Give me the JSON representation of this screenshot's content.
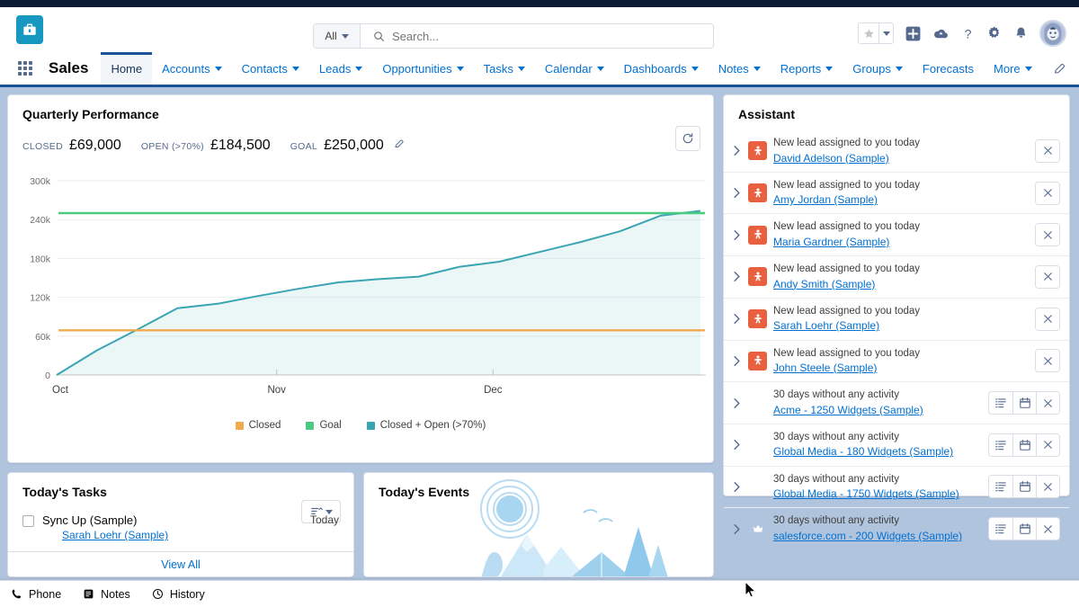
{
  "header": {
    "logo_icon": "briefcase-app-logo",
    "search": {
      "scope": "All",
      "placeholder": "Search...",
      "value": ""
    },
    "icons": [
      {
        "name": "favorites-star-icon",
        "glyph": "star"
      },
      {
        "name": "favorites-dropdown-icon",
        "glyph": "caret"
      },
      {
        "name": "global-actions-icon",
        "glyph": "plus"
      },
      {
        "name": "mobile-app-icon",
        "glyph": "cloud"
      },
      {
        "name": "help-icon",
        "glyph": "question"
      },
      {
        "name": "setup-gear-icon",
        "glyph": "gear"
      },
      {
        "name": "notifications-bell-icon",
        "glyph": "bell"
      },
      {
        "name": "user-avatar",
        "glyph": "avatar"
      }
    ]
  },
  "nav": {
    "app_name": "Sales",
    "items": [
      {
        "label": "Home",
        "has_caret": false,
        "active": true
      },
      {
        "label": "Accounts",
        "has_caret": true,
        "active": false
      },
      {
        "label": "Contacts",
        "has_caret": true,
        "active": false
      },
      {
        "label": "Leads",
        "has_caret": true,
        "active": false
      },
      {
        "label": "Opportunities",
        "has_caret": true,
        "active": false
      },
      {
        "label": "Tasks",
        "has_caret": true,
        "active": false
      },
      {
        "label": "Calendar",
        "has_caret": true,
        "active": false
      },
      {
        "label": "Dashboards",
        "has_caret": true,
        "active": false
      },
      {
        "label": "Notes",
        "has_caret": true,
        "active": false
      },
      {
        "label": "Reports",
        "has_caret": true,
        "active": false
      },
      {
        "label": "Groups",
        "has_caret": true,
        "active": false
      },
      {
        "label": "Forecasts",
        "has_caret": false,
        "active": false
      },
      {
        "label": "More",
        "has_caret": true,
        "active": false
      }
    ]
  },
  "performance": {
    "title": "Quarterly Performance",
    "refresh_icon": "refresh-icon",
    "edit_goal_icon": "pencil-icon",
    "kpis": [
      {
        "label": "CLOSED",
        "value": "£69,000"
      },
      {
        "label": "OPEN (>70%)",
        "value": "£184,500"
      },
      {
        "label": "GOAL",
        "value": "£250,000"
      }
    ]
  },
  "chart_data": {
    "type": "line",
    "title": "Quarterly Performance",
    "xlabel": "",
    "ylabel": "",
    "ylim": [
      0,
      300000
    ],
    "yticks": [
      0,
      60000,
      120000,
      180000,
      240000,
      300000
    ],
    "ytick_labels": [
      "0",
      "60k",
      "120k",
      "180k",
      "240k",
      "300k"
    ],
    "xticks": [
      "Oct",
      "Nov",
      "Dec"
    ],
    "grid": true,
    "legend_position": "bottom",
    "series": [
      {
        "name": "Closed",
        "color": "#f0ab4f",
        "kind": "constant-line",
        "value": 69000
      },
      {
        "name": "Goal",
        "color": "#4bca81",
        "kind": "constant-line",
        "value": 250000
      },
      {
        "name": "Closed + Open (>70%)",
        "color": "#3aa5b2",
        "kind": "cumulative-area",
        "x": [
          "Oct 1",
          "Oct 5",
          "Oct 9",
          "Oct 13",
          "Oct 20",
          "Oct 27",
          "Nov 3",
          "Nov 7",
          "Nov 12",
          "Nov 17",
          "Nov 22",
          "Nov 28",
          "Dec 5",
          "Dec 12",
          "Dec 20",
          "Dec 28",
          "Dec 31"
        ],
        "values": [
          0,
          38000,
          70000,
          103000,
          110000,
          122000,
          133000,
          143000,
          148000,
          152000,
          167000,
          175000,
          190000,
          205000,
          222000,
          246000,
          253500
        ]
      }
    ]
  },
  "assistant": {
    "title": "Assistant",
    "items": [
      {
        "icon": "lead-badge-icon",
        "type": "lead",
        "message": "New lead assigned to you today",
        "link": "David Adelson (Sample)",
        "actions": [
          "close-icon"
        ]
      },
      {
        "icon": "lead-badge-icon",
        "type": "lead",
        "message": "New lead assigned to you today",
        "link": "Amy Jordan (Sample)",
        "actions": [
          "close-icon"
        ]
      },
      {
        "icon": "lead-badge-icon",
        "type": "lead",
        "message": "New lead assigned to you today",
        "link": "Maria Gardner (Sample)",
        "actions": [
          "close-icon"
        ]
      },
      {
        "icon": "lead-badge-icon",
        "type": "lead",
        "message": "New lead assigned to you today",
        "link": "Andy Smith (Sample)",
        "actions": [
          "close-icon"
        ]
      },
      {
        "icon": "lead-badge-icon",
        "type": "lead",
        "message": "New lead assigned to you today",
        "link": "Sarah Loehr (Sample)",
        "actions": [
          "close-icon"
        ]
      },
      {
        "icon": "lead-badge-icon",
        "type": "lead",
        "message": "New lead assigned to you today",
        "link": "John Steele (Sample)",
        "actions": [
          "close-icon"
        ]
      },
      {
        "icon": "opportunity-badge-icon",
        "type": "opportunity",
        "message": "30 days without any activity",
        "link": "Acme - 1250 Widgets (Sample)",
        "actions": [
          "log-a-call-icon",
          "new-event-icon",
          "close-icon"
        ]
      },
      {
        "icon": "opportunity-badge-icon",
        "type": "opportunity",
        "message": "30 days without any activity",
        "link": "Global Media - 180 Widgets (Sample)",
        "actions": [
          "log-a-call-icon",
          "new-event-icon",
          "close-icon"
        ]
      },
      {
        "icon": "opportunity-badge-icon",
        "type": "opportunity",
        "message": "30 days without any activity",
        "link": "Global Media - 1750 Widgets (Sample)",
        "actions": [
          "log-a-call-icon",
          "new-event-icon",
          "close-icon"
        ]
      },
      {
        "icon": "opportunity-badge-icon",
        "type": "opportunity",
        "message": "30 days without any activity",
        "link": "salesforce.com - 200 Widgets (Sample)",
        "actions": [
          "log-a-call-icon",
          "new-event-icon",
          "close-icon"
        ]
      }
    ]
  },
  "tasks": {
    "title": "Today's Tasks",
    "sort_icon": "sort-icon",
    "items": [
      {
        "name": "Sync Up (Sample)",
        "related": "Sarah Loehr (Sample)",
        "due": "Today",
        "checked": false
      }
    ],
    "view_all": "View All"
  },
  "events": {
    "title": "Today's Events",
    "illustration": "camping-scene-illustration"
  },
  "utility_bar": {
    "items": [
      {
        "label": "Phone",
        "icon": "phone-icon"
      },
      {
        "label": "Notes",
        "icon": "notes-icon"
      },
      {
        "label": "History",
        "icon": "history-clock-icon"
      }
    ]
  },
  "colors": {
    "brand": "#1798c1",
    "nav_underline": "#1b5297",
    "link": "#0070d2",
    "closed": "#f0ab4f",
    "goal": "#4bca81",
    "closed_open": "#3aa5b2",
    "lead_badge": "#e8603f",
    "opportunity_badge": "#f0ab4f"
  }
}
